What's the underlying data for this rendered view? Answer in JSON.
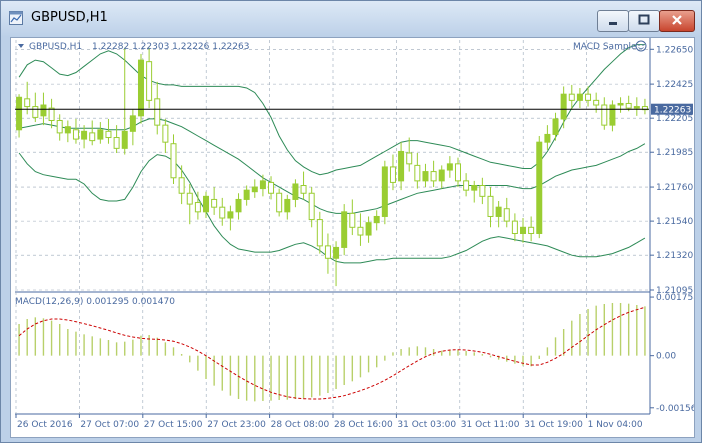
{
  "window": {
    "title": "GBPUSD,H1"
  },
  "chart_data": [
    {
      "type": "candlestick",
      "symbol_header": "GBPUSD,H1",
      "ohlc_header": "1.22282 1.22303 1.22226 1.22263",
      "indicator_label": "MACD Sample",
      "current_price_label": "1.22263",
      "current_price": 1.22263,
      "y_ticks": [
        "1.22650",
        "1.22425",
        "1.22205",
        "1.21985",
        "1.21760",
        "1.21540",
        "1.21320",
        "1.21095"
      ],
      "ylim": [
        1.21095,
        1.2271
      ],
      "grid": true,
      "colors": {
        "candle": "#9acd32",
        "band": "#2e8b57",
        "grid": "#9aa8b8",
        "price_line": "#000000"
      },
      "candles": [
        {
          "o": 1.2213,
          "h": 1.2236,
          "l": 1.2208,
          "c": 1.2234
        },
        {
          "o": 1.2233,
          "h": 1.2244,
          "l": 1.2223,
          "c": 1.2228
        },
        {
          "o": 1.2228,
          "h": 1.2237,
          "l": 1.2218,
          "c": 1.2221
        },
        {
          "o": 1.2222,
          "h": 1.2237,
          "l": 1.2216,
          "c": 1.2229
        },
        {
          "o": 1.2227,
          "h": 1.2233,
          "l": 1.2214,
          "c": 1.2219
        },
        {
          "o": 1.2219,
          "h": 1.2223,
          "l": 1.2206,
          "c": 1.2211
        },
        {
          "o": 1.2211,
          "h": 1.2219,
          "l": 1.2205,
          "c": 1.2215
        },
        {
          "o": 1.2213,
          "h": 1.222,
          "l": 1.2204,
          "c": 1.2207
        },
        {
          "o": 1.2207,
          "h": 1.2216,
          "l": 1.2201,
          "c": 1.2212
        },
        {
          "o": 1.2211,
          "h": 1.2219,
          "l": 1.2203,
          "c": 1.2206
        },
        {
          "o": 1.2207,
          "h": 1.2218,
          "l": 1.2204,
          "c": 1.2213
        },
        {
          "o": 1.2212,
          "h": 1.222,
          "l": 1.2204,
          "c": 1.2208
        },
        {
          "o": 1.2208,
          "h": 1.2216,
          "l": 1.2198,
          "c": 1.2201
        },
        {
          "o": 1.2201,
          "h": 1.2266,
          "l": 1.2197,
          "c": 1.2212
        },
        {
          "o": 1.2212,
          "h": 1.2226,
          "l": 1.2203,
          "c": 1.2222
        },
        {
          "o": 1.2222,
          "h": 1.2262,
          "l": 1.2217,
          "c": 1.2258
        },
        {
          "o": 1.2257,
          "h": 1.2266,
          "l": 1.2227,
          "c": 1.2232
        },
        {
          "o": 1.2233,
          "h": 1.2244,
          "l": 1.221,
          "c": 1.2216
        },
        {
          "o": 1.2216,
          "h": 1.222,
          "l": 1.2198,
          "c": 1.2205
        },
        {
          "o": 1.2204,
          "h": 1.221,
          "l": 1.2178,
          "c": 1.2182
        },
        {
          "o": 1.2182,
          "h": 1.219,
          "l": 1.2165,
          "c": 1.2172
        },
        {
          "o": 1.2172,
          "h": 1.2178,
          "l": 1.2152,
          "c": 1.2165
        },
        {
          "o": 1.2166,
          "h": 1.2173,
          "l": 1.2155,
          "c": 1.216
        },
        {
          "o": 1.216,
          "h": 1.2173,
          "l": 1.2156,
          "c": 1.217
        },
        {
          "o": 1.2168,
          "h": 1.2176,
          "l": 1.2158,
          "c": 1.2163
        },
        {
          "o": 1.2163,
          "h": 1.2169,
          "l": 1.2151,
          "c": 1.2156
        },
        {
          "o": 1.2156,
          "h": 1.2164,
          "l": 1.2148,
          "c": 1.216
        },
        {
          "o": 1.216,
          "h": 1.2172,
          "l": 1.2155,
          "c": 1.2168
        },
        {
          "o": 1.2168,
          "h": 1.2177,
          "l": 1.2164,
          "c": 1.2174
        },
        {
          "o": 1.2173,
          "h": 1.2181,
          "l": 1.2169,
          "c": 1.2176
        },
        {
          "o": 1.2175,
          "h": 1.2184,
          "l": 1.217,
          "c": 1.218
        },
        {
          "o": 1.2179,
          "h": 1.2183,
          "l": 1.2168,
          "c": 1.2172
        },
        {
          "o": 1.2172,
          "h": 1.2175,
          "l": 1.2157,
          "c": 1.216
        },
        {
          "o": 1.216,
          "h": 1.2171,
          "l": 1.2155,
          "c": 1.2168
        },
        {
          "o": 1.2168,
          "h": 1.2181,
          "l": 1.2163,
          "c": 1.2178
        },
        {
          "o": 1.2177,
          "h": 1.2186,
          "l": 1.2168,
          "c": 1.2172
        },
        {
          "o": 1.2172,
          "h": 1.2176,
          "l": 1.215,
          "c": 1.2155
        },
        {
          "o": 1.2155,
          "h": 1.216,
          "l": 1.2133,
          "c": 1.2138
        },
        {
          "o": 1.2138,
          "h": 1.2146,
          "l": 1.212,
          "c": 1.213
        },
        {
          "o": 1.213,
          "h": 1.2141,
          "l": 1.2112,
          "c": 1.2137
        },
        {
          "o": 1.2137,
          "h": 1.2165,
          "l": 1.2132,
          "c": 1.216
        },
        {
          "o": 1.2159,
          "h": 1.2168,
          "l": 1.2145,
          "c": 1.215
        },
        {
          "o": 1.215,
          "h": 1.2159,
          "l": 1.2138,
          "c": 1.2145
        },
        {
          "o": 1.2145,
          "h": 1.2157,
          "l": 1.214,
          "c": 1.2153
        },
        {
          "o": 1.2153,
          "h": 1.2161,
          "l": 1.2148,
          "c": 1.2157
        },
        {
          "o": 1.2157,
          "h": 1.2193,
          "l": 1.2152,
          "c": 1.2189
        },
        {
          "o": 1.2189,
          "h": 1.2197,
          "l": 1.2174,
          "c": 1.2179
        },
        {
          "o": 1.218,
          "h": 1.2205,
          "l": 1.2174,
          "c": 1.2199
        },
        {
          "o": 1.2198,
          "h": 1.2208,
          "l": 1.2186,
          "c": 1.2191
        },
        {
          "o": 1.219,
          "h": 1.2198,
          "l": 1.2175,
          "c": 1.218
        },
        {
          "o": 1.218,
          "h": 1.2191,
          "l": 1.2176,
          "c": 1.2186
        },
        {
          "o": 1.2186,
          "h": 1.2193,
          "l": 1.2176,
          "c": 1.218
        },
        {
          "o": 1.218,
          "h": 1.219,
          "l": 1.2175,
          "c": 1.2187
        },
        {
          "o": 1.2187,
          "h": 1.2196,
          "l": 1.2182,
          "c": 1.2191
        },
        {
          "o": 1.2191,
          "h": 1.2195,
          "l": 1.2176,
          "c": 1.218
        },
        {
          "o": 1.218,
          "h": 1.2185,
          "l": 1.217,
          "c": 1.2174
        },
        {
          "o": 1.2174,
          "h": 1.218,
          "l": 1.2166,
          "c": 1.2177
        },
        {
          "o": 1.2177,
          "h": 1.2182,
          "l": 1.2165,
          "c": 1.217
        },
        {
          "o": 1.217,
          "h": 1.2176,
          "l": 1.215,
          "c": 1.2157
        },
        {
          "o": 1.2157,
          "h": 1.2167,
          "l": 1.215,
          "c": 1.2163
        },
        {
          "o": 1.2162,
          "h": 1.2169,
          "l": 1.215,
          "c": 1.2154
        },
        {
          "o": 1.2154,
          "h": 1.2159,
          "l": 1.2141,
          "c": 1.2146
        },
        {
          "o": 1.2146,
          "h": 1.2156,
          "l": 1.214,
          "c": 1.215
        },
        {
          "o": 1.215,
          "h": 1.2157,
          "l": 1.2141,
          "c": 1.2146
        },
        {
          "o": 1.2146,
          "h": 1.2209,
          "l": 1.2143,
          "c": 1.2205
        },
        {
          "o": 1.2205,
          "h": 1.2216,
          "l": 1.22,
          "c": 1.221
        },
        {
          "o": 1.221,
          "h": 1.2224,
          "l": 1.2206,
          "c": 1.222
        },
        {
          "o": 1.222,
          "h": 1.2241,
          "l": 1.2214,
          "c": 1.2236
        },
        {
          "o": 1.2236,
          "h": 1.2242,
          "l": 1.2226,
          "c": 1.2232
        },
        {
          "o": 1.2232,
          "h": 1.224,
          "l": 1.2227,
          "c": 1.2236
        },
        {
          "o": 1.2236,
          "h": 1.2241,
          "l": 1.2228,
          "c": 1.2232
        },
        {
          "o": 1.2232,
          "h": 1.2237,
          "l": 1.2224,
          "c": 1.2229
        },
        {
          "o": 1.2229,
          "h": 1.2234,
          "l": 1.2213,
          "c": 1.2216
        },
        {
          "o": 1.2216,
          "h": 1.2232,
          "l": 1.2212,
          "c": 1.2229
        },
        {
          "o": 1.2229,
          "h": 1.2234,
          "l": 1.2224,
          "c": 1.223
        },
        {
          "o": 1.223,
          "h": 1.2235,
          "l": 1.2225,
          "c": 1.2227
        },
        {
          "o": 1.2227,
          "h": 1.2234,
          "l": 1.2222,
          "c": 1.2228
        },
        {
          "o": 1.2228,
          "h": 1.2233,
          "l": 1.2223,
          "c": 1.2226
        }
      ],
      "bollinger": {
        "upper": [
          1.2247,
          1.2255,
          1.2258,
          1.2257,
          1.2253,
          1.2249,
          1.2248,
          1.225,
          1.2254,
          1.2258,
          1.2262,
          1.2264,
          1.2262,
          1.2258,
          1.2253,
          1.2248,
          1.2245,
          1.2243,
          1.2242,
          1.2242,
          1.2241,
          1.2241,
          1.2241,
          1.2241,
          1.2241,
          1.2241,
          1.2241,
          1.2241,
          1.224,
          1.2237,
          1.223,
          1.2221,
          1.2209,
          1.22,
          1.2193,
          1.2189,
          1.2186,
          1.2184,
          1.2185,
          1.2187,
          1.2188,
          1.2189,
          1.219,
          1.2193,
          1.2196,
          1.2199,
          1.2202,
          1.2205,
          1.2206,
          1.2206,
          1.2205,
          1.2204,
          1.2203,
          1.2202,
          1.22,
          1.2198,
          1.2196,
          1.2194,
          1.2192,
          1.2191,
          1.219,
          1.2189,
          1.2188,
          1.2188,
          1.2192,
          1.2199,
          1.2208,
          1.2218,
          1.2227,
          1.2234,
          1.224,
          1.2246,
          1.2252,
          1.2257,
          1.2262,
          1.2266,
          1.2268,
          1.2268
        ],
        "middle": [
          1.2214,
          1.2215,
          1.2216,
          1.2217,
          1.2216,
          1.2215,
          1.2214,
          1.2214,
          1.2214,
          1.2214,
          1.2214,
          1.2213,
          1.2213,
          1.2213,
          1.2215,
          1.2218,
          1.222,
          1.222,
          1.2219,
          1.2217,
          1.2215,
          1.2212,
          1.2209,
          1.2206,
          1.2203,
          1.22,
          1.2197,
          1.2194,
          1.219,
          1.2186,
          1.2182,
          1.2179,
          1.2176,
          1.2173,
          1.217,
          1.2168,
          1.2165,
          1.2162,
          1.216,
          1.2159,
          1.2159,
          1.2159,
          1.216,
          1.2161,
          1.2162,
          1.2164,
          1.2166,
          1.2168,
          1.217,
          1.2172,
          1.2173,
          1.2174,
          1.2175,
          1.2176,
          1.2177,
          1.2177,
          1.2177,
          1.2177,
          1.2177,
          1.2177,
          1.2177,
          1.2176,
          1.2175,
          1.2175,
          1.2177,
          1.218,
          1.2183,
          1.2185,
          1.2187,
          1.2188,
          1.2189,
          1.219,
          1.2192,
          1.2194,
          1.2196,
          1.2199,
          1.2201,
          1.2204
        ],
        "lower": [
          1.2198,
          1.2191,
          1.2186,
          1.2184,
          1.2183,
          1.2182,
          1.2181,
          1.2181,
          1.2178,
          1.2172,
          1.2168,
          1.2167,
          1.2167,
          1.2168,
          1.2176,
          1.2186,
          1.2193,
          1.2197,
          1.2196,
          1.2193,
          1.2187,
          1.2179,
          1.2169,
          1.216,
          1.2151,
          1.2144,
          1.2139,
          1.2136,
          1.2135,
          1.2134,
          1.2134,
          1.2134,
          1.2135,
          1.2137,
          1.2139,
          1.214,
          1.2138,
          1.2135,
          1.2131,
          1.2128,
          1.2127,
          1.2127,
          1.2127,
          1.2128,
          1.2129,
          1.2129,
          1.213,
          1.213,
          1.213,
          1.213,
          1.213,
          1.213,
          1.213,
          1.2131,
          1.2133,
          1.2135,
          1.2138,
          1.2141,
          1.2143,
          1.2144,
          1.2143,
          1.2142,
          1.2141,
          1.214,
          1.2139,
          1.2138,
          1.2136,
          1.2134,
          1.2132,
          1.2131,
          1.2131,
          1.2131,
          1.2132,
          1.2133,
          1.2135,
          1.2137,
          1.214,
          1.2143
        ]
      }
    },
    {
      "type": "bar",
      "indicator_header": "MACD(12,26,9) 0.001295 0.001470",
      "y_ticks": [
        "0.001758",
        "0.00",
        "-0.001564"
      ],
      "ylim": [
        -0.00175,
        0.00185
      ],
      "colors": {
        "histogram": "#b8d06a",
        "signal": "#cc0000"
      },
      "histogram": [
        0.00095,
        0.0011,
        0.00115,
        0.00112,
        0.00105,
        0.00095,
        0.0008,
        0.00072,
        0.00064,
        0.00058,
        0.00052,
        0.00047,
        0.0004,
        0.00042,
        0.00048,
        0.0006,
        0.00062,
        0.00054,
        0.0004,
        0.00025,
        5e-05,
        -0.0002,
        -0.00045,
        -0.0007,
        -0.0009,
        -0.00105,
        -0.0012,
        -0.0013,
        -0.00135,
        -0.00137,
        -0.00136,
        -0.00135,
        -0.00133,
        -0.00132,
        -0.0013,
        -0.00128,
        -0.00125,
        -0.0012,
        -0.00112,
        -0.001,
        -0.00088,
        -0.00077,
        -0.00065,
        -0.0005,
        -0.00035,
        -0.00015,
        0.0001,
        0.0002,
        0.00025,
        0.00028,
        0.00025,
        0.0002,
        0.00015,
        0.00016,
        0.00018,
        0.00014,
        0.0001,
        5e-05,
        -5e-05,
        -0.00012,
        -0.00018,
        -0.00024,
        -0.0003,
        -0.00032,
        -0.0001,
        0.00025,
        0.00055,
        0.0008,
        0.00105,
        0.00125,
        0.0014,
        0.0015,
        0.00155,
        0.00158,
        0.00158,
        0.00156,
        0.00152,
        0.00148
      ],
      "signal": [
        0.0006,
        0.0008,
        0.00095,
        0.00105,
        0.0011,
        0.0011,
        0.00107,
        0.00102,
        0.00096,
        0.0009,
        0.00083,
        0.00076,
        0.00068,
        0.00061,
        0.00056,
        0.00052,
        0.0005,
        0.00049,
        0.00047,
        0.00043,
        0.00036,
        0.00026,
        0.00014,
        0.0,
        -0.00016,
        -0.00032,
        -0.00047,
        -0.00062,
        -0.00076,
        -0.00089,
        -0.001,
        -0.0011,
        -0.00117,
        -0.00123,
        -0.00127,
        -0.00129,
        -0.0013,
        -0.0013,
        -0.00128,
        -0.00125,
        -0.0012,
        -0.00113,
        -0.00105,
        -0.00096,
        -0.00086,
        -0.00074,
        -0.0006,
        -0.00045,
        -0.0003,
        -0.00016,
        -3e-05,
        7e-05,
        0.00013,
        0.00017,
        0.00018,
        0.00017,
        0.00014,
        0.0001,
        4e-05,
        -3e-05,
        -0.0001,
        -0.00017,
        -0.00023,
        -0.00028,
        -0.00028,
        -0.0002,
        -8e-05,
        7e-05,
        0.00025,
        0.00042,
        0.0006,
        0.00078,
        0.00093,
        0.00107,
        0.0012,
        0.0013,
        0.00138,
        0.00145
      ]
    }
  ],
  "x_ticks": [
    "26 Oct 2016",
    "27 Oct 07:00",
    "27 Oct 15:00",
    "27 Oct 23:00",
    "28 Oct 08:00",
    "28 Oct 16:00",
    "31 Oct 03:00",
    "31 Oct 11:00",
    "31 Oct 19:00",
    "1 Nov 04:00"
  ]
}
